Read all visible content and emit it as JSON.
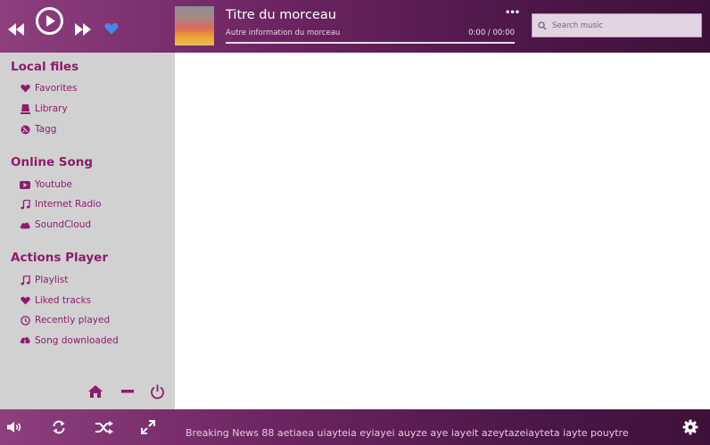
{
  "player": {
    "track_title": "Titre du morceau",
    "track_subtitle": "Autre information du morceau",
    "time": "0:00 / 00:00",
    "more_label": "•••",
    "progress": 0
  },
  "search": {
    "placeholder": "Search music"
  },
  "sidebar": {
    "sections": [
      {
        "title": "Local files",
        "items": [
          {
            "label": "Favorites",
            "icon": "heart-icon"
          },
          {
            "label": "Library",
            "icon": "library-icon"
          },
          {
            "label": "Tagg",
            "icon": "tag-icon"
          }
        ]
      },
      {
        "title": "Online Song",
        "items": [
          {
            "label": "Youtube",
            "icon": "youtube-icon"
          },
          {
            "label": "Internet Radio",
            "icon": "music-note-icon"
          },
          {
            "label": "SoundCloud",
            "icon": "cloud-icon"
          }
        ]
      },
      {
        "title": "Actions Player",
        "items": [
          {
            "label": "Playlist",
            "icon": "music-note-icon"
          },
          {
            "label": "Liked tracks",
            "icon": "heart-icon"
          },
          {
            "label": "Recently played",
            "icon": "clock-icon"
          },
          {
            "label": "Song downloaded",
            "icon": "cloud-download-icon"
          }
        ]
      }
    ]
  },
  "footer": {
    "ticker": "Breaking News 88 aetiaea uiayteia eyiayei auyze aye iayeit azeytazeiayteta iayte pouytre"
  },
  "colors": {
    "accent": "#8d1c6e",
    "header_start": "#8d3f7e",
    "header_end": "#3e1139",
    "sidebar_bg": "#d1d1d1",
    "heart_blue": "#4a86e8"
  }
}
